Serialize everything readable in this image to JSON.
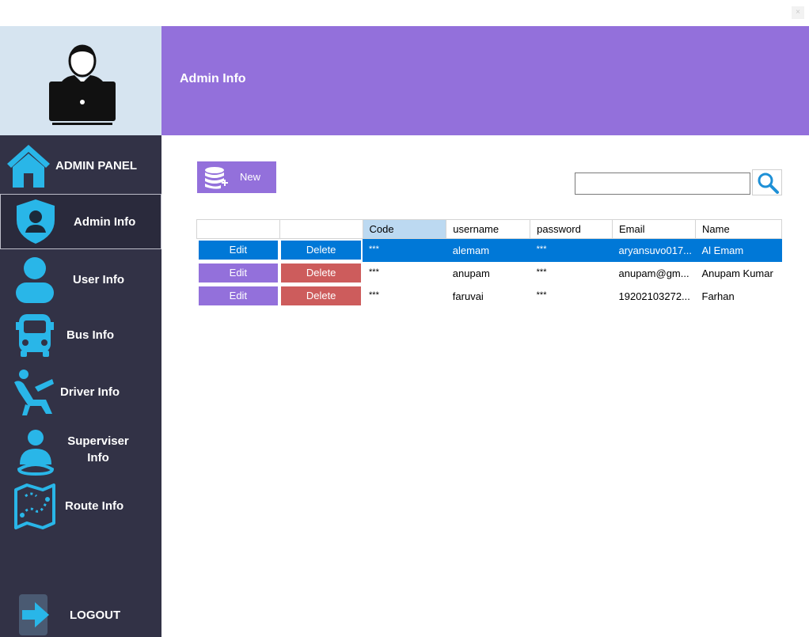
{
  "window": {
    "close_glyph": "×"
  },
  "header": {
    "title": "Admin Info"
  },
  "sidebar": {
    "panel_title": "ADMIN PANEL",
    "items": [
      {
        "label": "Admin Info",
        "icon": "shield-user-icon"
      },
      {
        "label": "User Info",
        "icon": "user-icon"
      },
      {
        "label": "Bus Info",
        "icon": "bus-icon"
      },
      {
        "label": "Driver Info",
        "icon": "driver-icon"
      },
      {
        "label": "Superviser Info",
        "icon": "supervisor-icon"
      },
      {
        "label": "Route Info",
        "icon": "map-icon"
      }
    ],
    "logout_label": "LOGOUT"
  },
  "toolbar": {
    "new_label": "New",
    "search_value": ""
  },
  "grid": {
    "columns": [
      "",
      "",
      "Code",
      "username",
      "password",
      "Email",
      "Name"
    ],
    "rows": [
      {
        "edit": "Edit",
        "delete": "Delete",
        "code": "***",
        "username": "alemam",
        "password": "***",
        "email": "aryansuvo017...",
        "name": "Al Emam"
      },
      {
        "edit": "Edit",
        "delete": "Delete",
        "code": "***",
        "username": "anupam",
        "password": "***",
        "email": "anupam@gm...",
        "name": "Anupam Kumar"
      },
      {
        "edit": "Edit",
        "delete": "Delete",
        "code": "***",
        "username": "faruvai",
        "password": "***",
        "email": "19202103272...",
        "name": "Farhan"
      }
    ]
  },
  "colors": {
    "accent": "#9370db",
    "sidebar": "#323246",
    "icon": "#29b6e8",
    "delete": "#cd5c5c",
    "selected": "#0078d7"
  }
}
